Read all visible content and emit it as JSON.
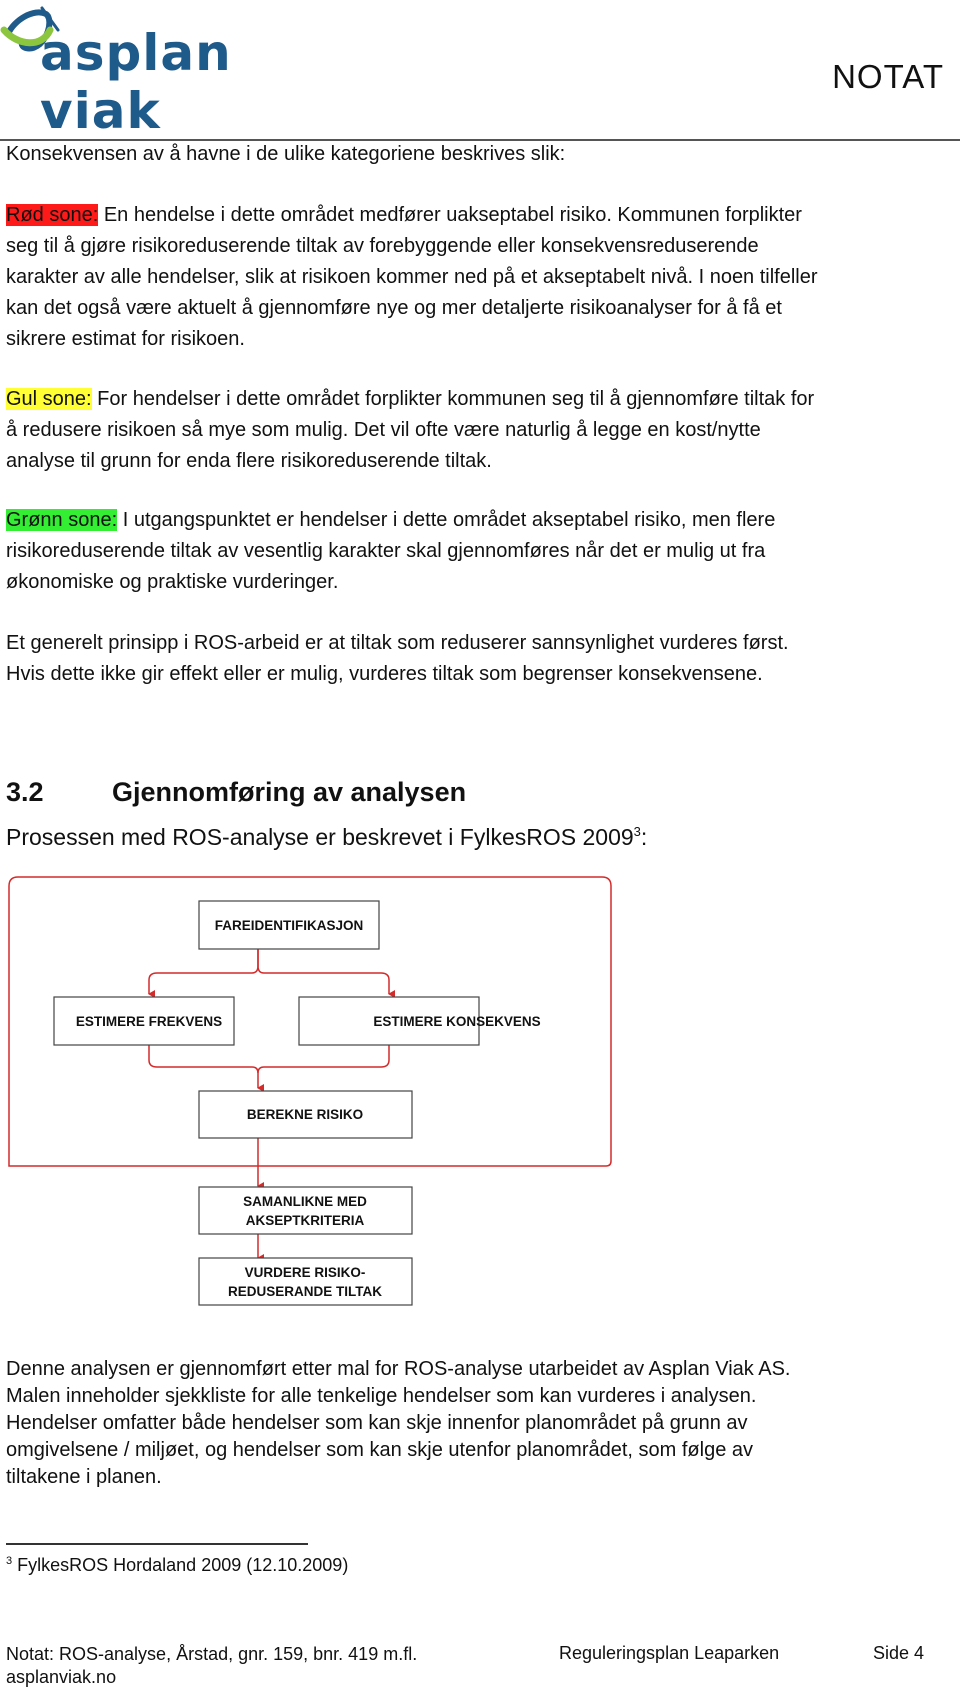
{
  "header": {
    "logo_text": "asplan viak",
    "doc_type": "NOTAT",
    "brand_colors": {
      "blue": "#1e5a8a",
      "green": "#8cc63f"
    }
  },
  "intro_line": "Konsekvensen av å havne i de ulike kategoriene beskrives slik:",
  "zones": [
    {
      "label": "Rød sone:",
      "color": "#ff1a1a",
      "lines": [
        " En hendelse i dette området medfører uakseptabel risiko. Kommunen forplikter",
        "seg til å gjøre risikoreduserende tiltak av forebyggende eller konsekvensreduserende",
        "karakter av alle hendelser, slik at risikoen kommer ned på et akseptabelt nivå. I noen tilfeller",
        "kan det også være aktuelt å gjennomføre nye og mer detaljerte risikoanalyser for å få et",
        "sikrere estimat for risikoen."
      ]
    },
    {
      "label": "Gul sone:",
      "color": "#ffff33",
      "lines": [
        " For hendelser i dette området forplikter kommunen seg til å gjennomføre tiltak for",
        "å redusere risikoen så mye som mulig. Det vil ofte være naturlig å legge en kost/nytte",
        "analyse til grunn for enda flere risikoreduserende tiltak."
      ]
    },
    {
      "label": "Grønn sone:",
      "color": "#33ee33",
      "lines": [
        " I utgangspunktet er hendelser i dette området akseptabel risiko, men flere",
        "risikoreduserende tiltak av vesentlig karakter skal gjennomføres når det er mulig ut fra",
        "økonomiske og praktiske vurderinger."
      ]
    }
  ],
  "principle": [
    "Et generelt prinsipp i ROS-arbeid er at tiltak som reduserer sannsynlighet vurderes først.",
    "Hvis dette ikke gir effekt eller er mulig, vurderes tiltak som begrenser konsekvensene."
  ],
  "section": {
    "number": "3.2",
    "title": "Gjennomføring av analysen",
    "intro": "Prosessen med ROS-analyse er beskrevet i FylkesROS 2009",
    "intro_footnote_ref": "3",
    "intro_suffix": ":"
  },
  "diagram": {
    "accent_color": "#d42a2a",
    "boxes": [
      {
        "id": "fareidentifikasjon",
        "lines": [
          "FAREIDENTIFIKASJON"
        ]
      },
      {
        "id": "estimere-frekvens",
        "lines": [
          "ESTIMERE FREKVENS"
        ]
      },
      {
        "id": "estimere-konsekvens",
        "lines": [
          "ESTIMERE KONSEKVENS"
        ]
      },
      {
        "id": "berekne-risiko",
        "lines": [
          "BEREKNE RISIKO"
        ]
      },
      {
        "id": "samanlikne",
        "lines": [
          "SAMANLIKNE MED",
          "AKSEPTKRITERIA"
        ]
      },
      {
        "id": "vurdere",
        "lines": [
          "VURDERE RISIKO-",
          "REDUSERANDE TILTAK"
        ]
      }
    ]
  },
  "template_text": [
    "Denne analysen er gjennomført etter mal for ROS-analyse utarbeidet av Asplan Viak AS.",
    "Malen inneholder sjekkliste for alle tenkelige hendelser som kan vurderes i analysen.",
    "Hendelser omfatter både hendelser som kan skje innenfor planområdet på grunn av",
    "omgivelsene / miljøet, og hendelser som kan skje utenfor planområdet, som følge av",
    "tiltakene i planen."
  ],
  "footnote": {
    "ref": "3",
    "text": " FylkesROS Hordaland 2009  (12.10.2009)"
  },
  "footer": {
    "left_line1": "Notat: ROS-analyse, Årstad, gnr. 159, bnr. 419 m.fl.",
    "left_line2": "asplanviak.no",
    "middle": "Reguleringsplan Leaparken",
    "page": "Side 4"
  }
}
